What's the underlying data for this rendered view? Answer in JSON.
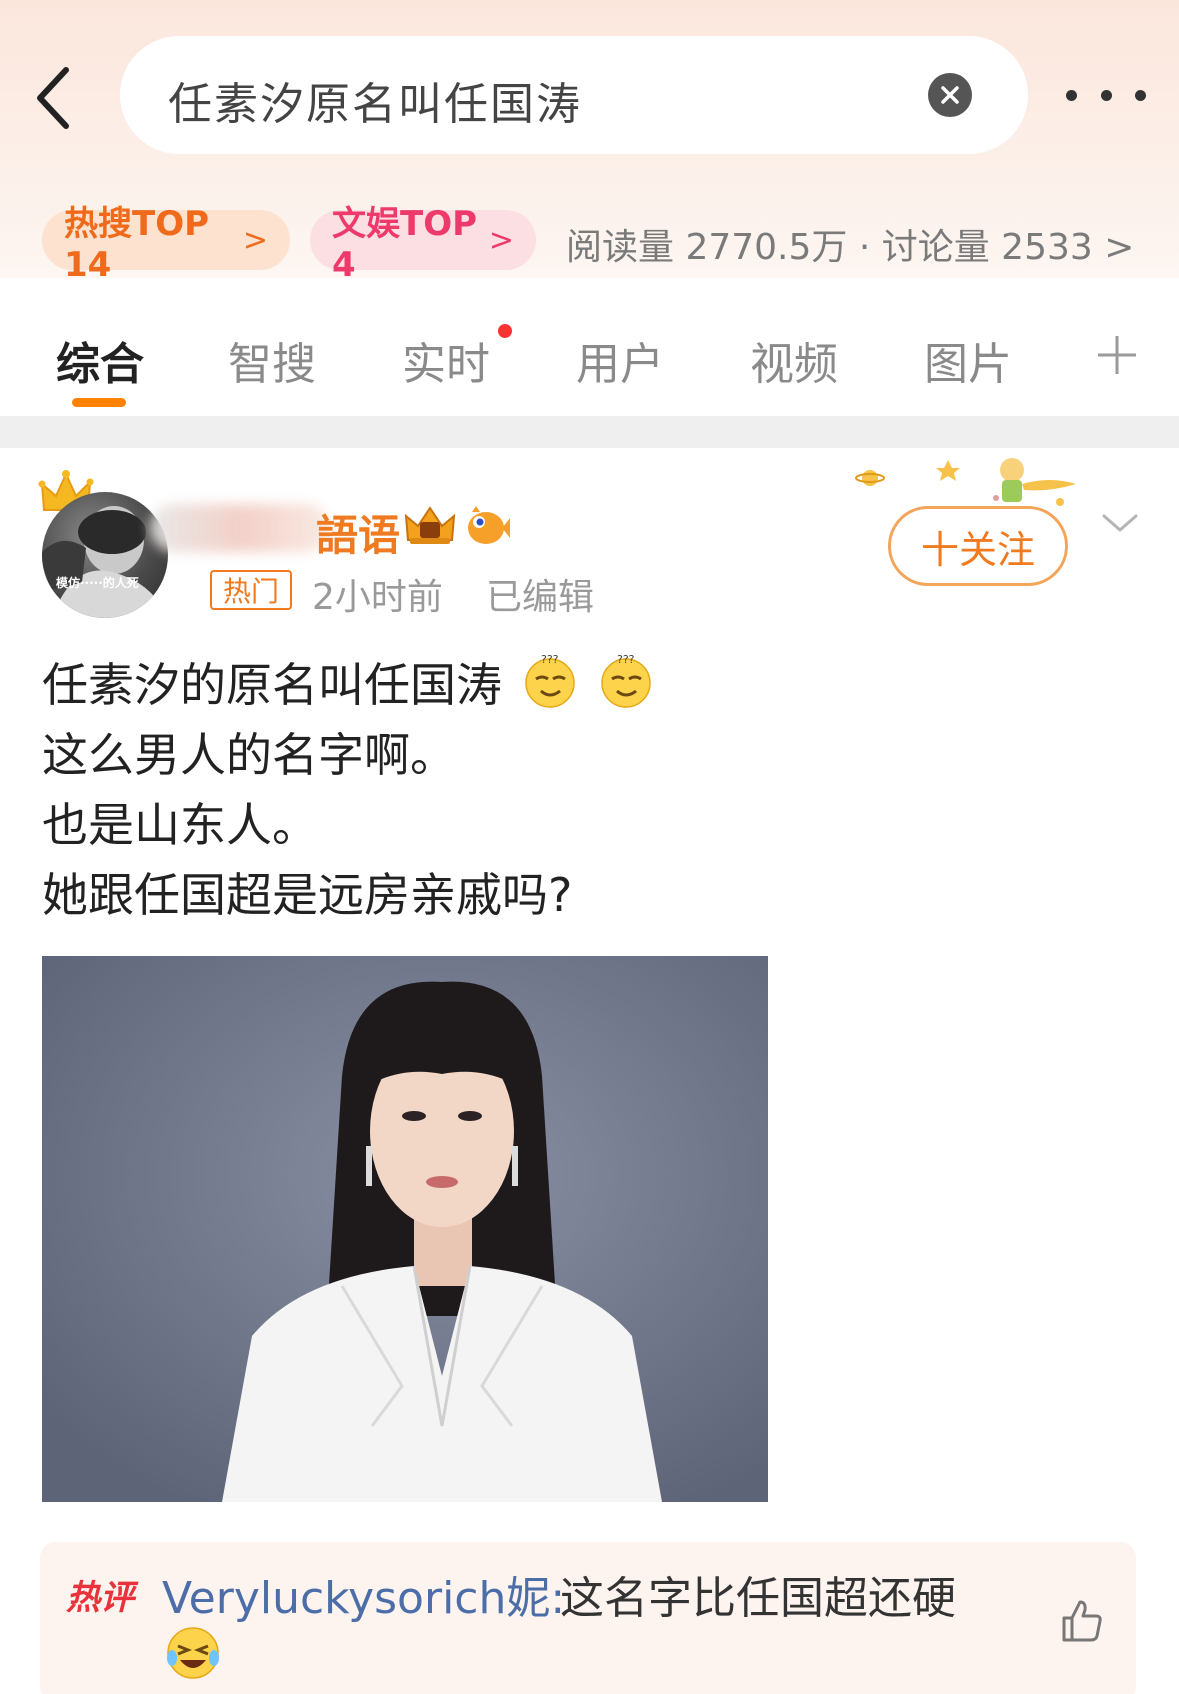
{
  "search": {
    "query": "任素汐原名叫任国涛"
  },
  "pills": {
    "hot_search": "热搜TOP 14",
    "entertainment": "文娱TOP 4",
    "chevron": ">"
  },
  "stats": {
    "text": "阅读量 2770.5万 · 讨论量 2533 >"
  },
  "tabs": [
    {
      "label": "综合"
    },
    {
      "label": "智搜"
    },
    {
      "label": "实时"
    },
    {
      "label": "用户"
    },
    {
      "label": "视频"
    },
    {
      "label": "图片"
    }
  ],
  "post": {
    "username_visible": "語语",
    "avatar_caption": "模仿·····的人死",
    "hot_tag": "热门",
    "time": "2小时前",
    "edited": "已编辑",
    "follow_label": "十关注",
    "lines": [
      "任素汐的原名叫任国涛",
      "这么男人的名字啊。",
      "也是山东人。",
      "她跟任国超是远房亲戚吗?"
    ]
  },
  "comment": {
    "tag": "热评",
    "user": "Veryluckysorich妮:",
    "text": "这名字比任国超还硬"
  },
  "colors": {
    "accent_orange": "#ff8200",
    "hot_pink": "#ee3a6a",
    "comment_user_blue": "#4c6ea8"
  }
}
